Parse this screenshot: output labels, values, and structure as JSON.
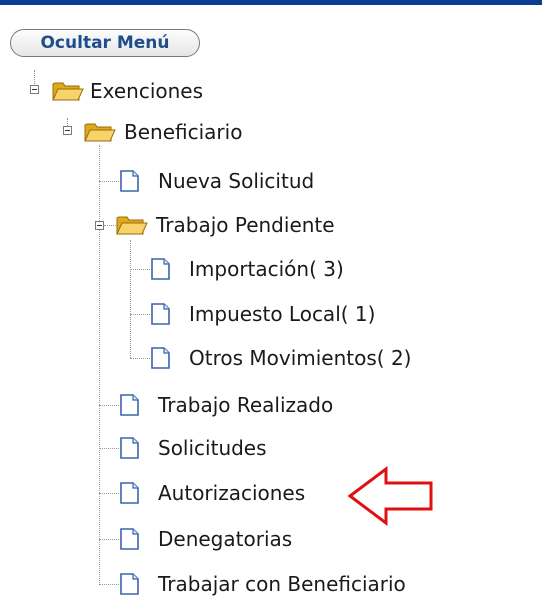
{
  "header": {
    "hide_menu_label": "Ocultar Menú"
  },
  "tree": {
    "root": {
      "label": "Exenciones",
      "icon": "folder-open-icon"
    },
    "beneficiario": {
      "label": "Beneficiario",
      "icon": "folder-open-icon"
    },
    "nueva_solicitud": {
      "label": "Nueva Solicitud",
      "icon": "document-icon"
    },
    "trabajo_pendiente": {
      "label": "Trabajo Pendiente",
      "icon": "folder-open-icon"
    },
    "importacion": {
      "label": "Importación( 3)",
      "icon": "document-icon"
    },
    "impuesto_local": {
      "label": "Impuesto Local( 1)",
      "icon": "document-icon"
    },
    "otros_movimientos": {
      "label": "Otros Movimientos( 2)",
      "icon": "document-icon"
    },
    "trabajo_realizado": {
      "label": "Trabajo Realizado",
      "icon": "document-icon"
    },
    "solicitudes": {
      "label": "Solicitudes",
      "icon": "document-icon"
    },
    "autorizaciones": {
      "label": "Autorizaciones",
      "icon": "document-icon"
    },
    "denegatorias": {
      "label": "Denegatorias",
      "icon": "document-icon"
    },
    "trabajar_beneficiario": {
      "label": "Trabajar con Beneficiario",
      "icon": "document-icon"
    }
  },
  "annotation": {
    "arrow_icon": "red-arrow-left-icon",
    "arrow_color": "#e01010"
  },
  "colors": {
    "top_bar": "#0b3d91",
    "button_text": "#1f4e8c",
    "folder": "#f2c94c",
    "document": "#4a78c2"
  }
}
